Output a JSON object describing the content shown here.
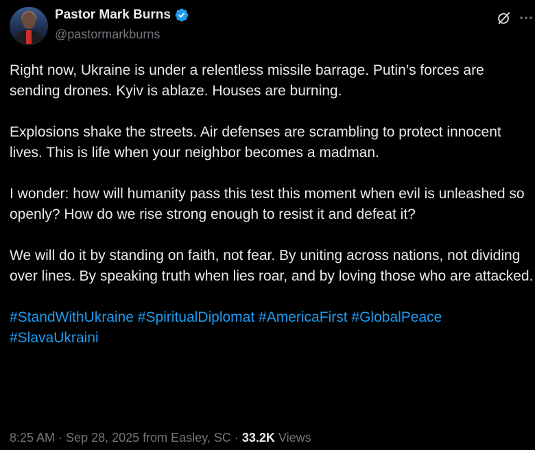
{
  "author": {
    "display_name": "Pastor Mark Burns",
    "handle": "@pastormarkburns",
    "verified_badge_color": "#1d9bf0"
  },
  "icons": {
    "header_actions": [
      "grok-icon",
      "more-icon"
    ]
  },
  "post": {
    "paragraphs": [
      "Right now, Ukraine is under a relentless missile barrage. Putin’s forces are sending drones. Kyiv is ablaze. Houses are burning.",
      "Explosions shake the streets. Air defenses are scrambling to protect innocent lives. This is life when your neighbor becomes a madman.",
      "I wonder: how will humanity pass this test this moment when evil is unleashed so openly? How do we rise strong enough to resist it and defeat it?",
      "We will do it by standing on faith, not fear. By uniting across nations, not dividing over lines. By speaking truth when lies roar, and by loving those who are attacked."
    ],
    "hashtags": [
      "#StandWithUkraine",
      "#SpiritualDiplomat",
      "#AmericaFirst",
      "#GlobalPeace",
      "#SlavaUkraini"
    ]
  },
  "meta": {
    "time": "8:25 AM",
    "separator": " · ",
    "date": "Sep 28, 2025",
    "location": "from Easley, SC",
    "views_count": "33.2K",
    "views_label": "Views"
  },
  "colors": {
    "background": "#000000",
    "text": "#e7e9ea",
    "secondary_text": "#71767b",
    "link": "#1d9bf0"
  }
}
